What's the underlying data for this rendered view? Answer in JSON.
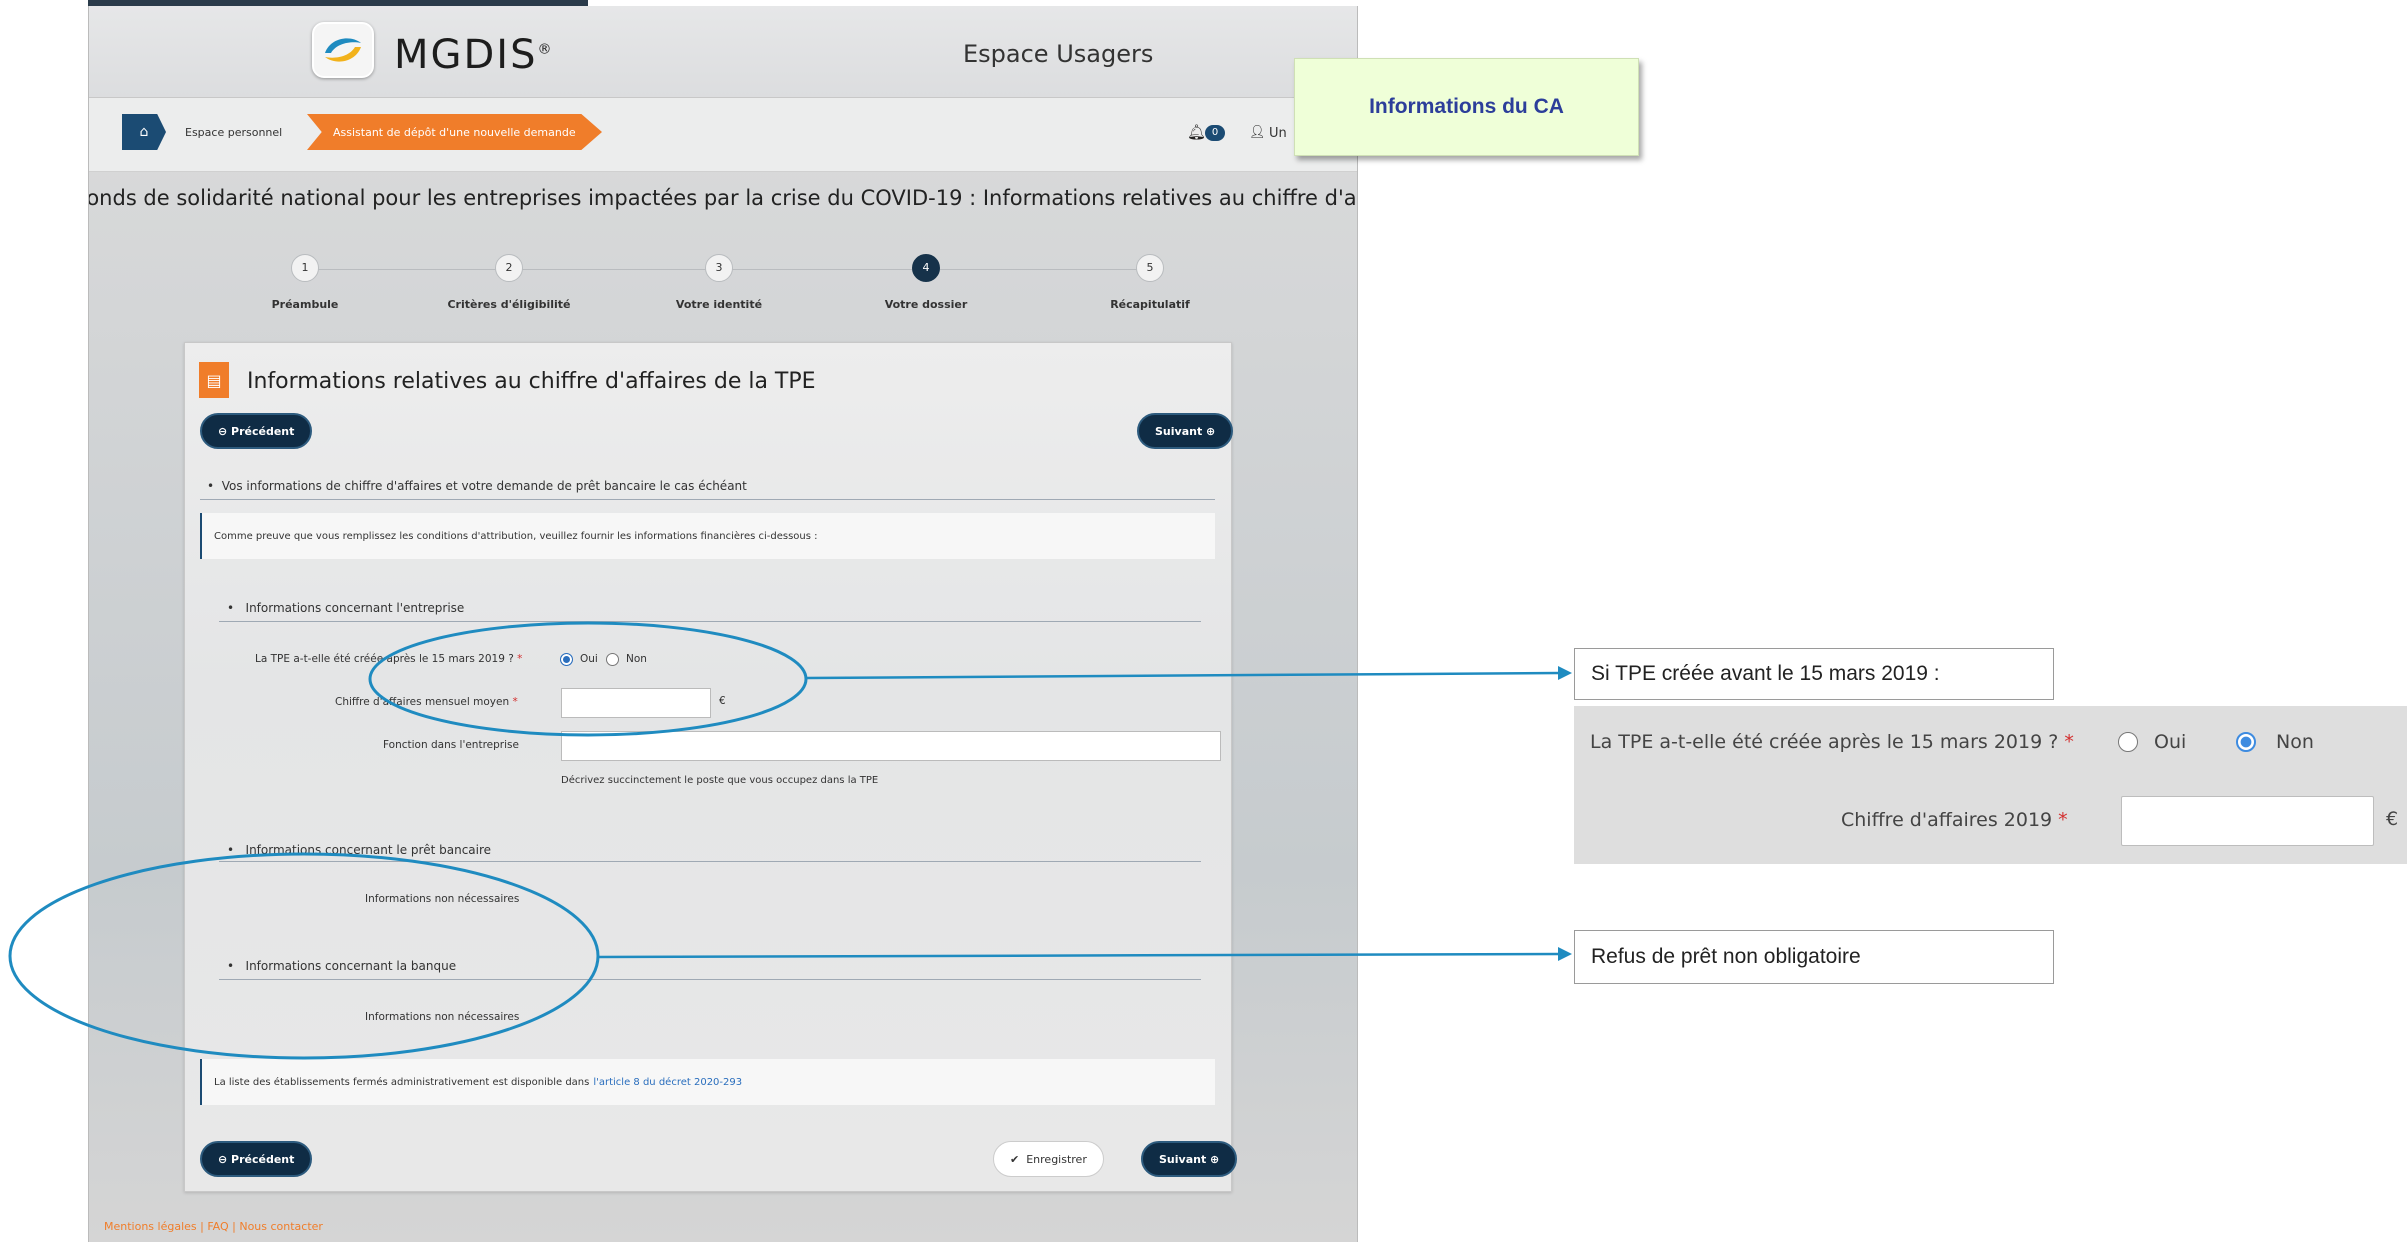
{
  "header": {
    "logo_text": "MGDIS",
    "logo_registered": "®",
    "title": "Espace Usagers"
  },
  "breadcrumb": {
    "personal": "Espace personnel",
    "active": "Assistant de dépôt d'une nouvelle demande"
  },
  "user_bar": {
    "notification_count": "0",
    "user_label": "Un"
  },
  "page_heading": "Fonds de solidarité national pour les entreprises impactées par la crise du COVID-19 : Informations relatives au chiffre d'affaire...",
  "stepper": {
    "steps": [
      {
        "number": "1",
        "label": "Préambule"
      },
      {
        "number": "2",
        "label": "Critères d'éligibilité"
      },
      {
        "number": "3",
        "label": "Votre identité"
      },
      {
        "number": "4",
        "label": "Votre dossier"
      },
      {
        "number": "5",
        "label": "Récapitulatif"
      }
    ],
    "active_step": 4
  },
  "card": {
    "title": "Informations relatives au chiffre d'affaires de la TPE",
    "previous_label": "Précédent",
    "next_label": "Suivant",
    "save_label": "Enregistrer",
    "section_main": "Vos informations de chiffre d'affaires et votre demande de prêt bancaire le cas échéant",
    "proof_text": "Comme preuve que vous remplissez les conditions d'attribution, veuillez fournir les informations financières ci-dessous :",
    "section_company": "Informations concernant l'entreprise",
    "question_created": "La TPE a-t-elle été créée après le 15 mars 2019 ?",
    "required_mark": "*",
    "yes_label": "Oui",
    "no_label": "Non",
    "selected_option": "Oui",
    "monthly_revenue_label": "Chiffre d'affaires mensuel moyen",
    "currency": "€",
    "monthly_revenue_value": "",
    "function_label": "Fonction dans l'entreprise",
    "function_value": "",
    "function_help": "Décrivez succinctement le poste que vous occupez dans la TPE",
    "section_loan": "Informations concernant le prêt bancaire",
    "not_needed_1": "Informations non nécessaires",
    "section_bank": "Informations concernant la banque",
    "not_needed_2": "Informations non nécessaires",
    "closed_list_text": "La liste des établissements fermés administrativement est disponible dans",
    "closed_list_link": "l'article 8 du décret 2020-293"
  },
  "footer": {
    "links": "Mentions légales | FAQ | Nous contacter"
  },
  "annotations": {
    "ca_note": "Informations du CA",
    "callout_before_2019": "Si TPE créée avant le 15 mars 2019 :",
    "callout_loan": "Refus de prêt non obligatoire",
    "ca_panel": {
      "question": "La TPE a-t-elle été créée après le 15 mars 2019 ?",
      "required_mark": "*",
      "yes_label": "Oui",
      "no_label": "Non",
      "selected_option": "Non",
      "revenue_label": "Chiffre d'affaires 2019",
      "currency": "€",
      "revenue_value": ""
    }
  },
  "colors": {
    "brand_orange": "#f07d2a",
    "dark_navy": "#0f2c45",
    "annotation_blue": "#1f8bc0",
    "note_background": "#efffd8"
  }
}
